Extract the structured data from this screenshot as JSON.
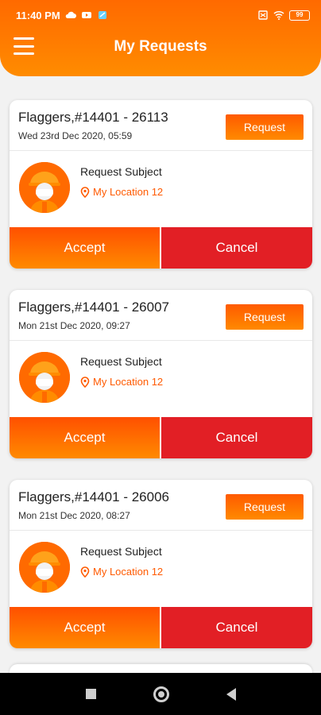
{
  "status_bar": {
    "time": "11:40 PM",
    "battery": "99"
  },
  "header": {
    "title": "My Requests"
  },
  "colors": {
    "primary_orange": "#ff6a00",
    "cancel_red": "#e21f25",
    "location_orange": "#ff5a00"
  },
  "requests": [
    {
      "title": "Flaggers,#14401 - 26113",
      "date": "Wed 23rd Dec 2020, 05:59",
      "request_label": "Request",
      "subject": "Request Subject",
      "location": "My Location 12",
      "accept_label": "Accept",
      "cancel_label": "Cancel"
    },
    {
      "title": "Flaggers,#14401 - 26007",
      "date": "Mon 21st Dec 2020, 09:27",
      "request_label": "Request",
      "subject": "Request Subject",
      "location": "My Location 12",
      "accept_label": "Accept",
      "cancel_label": "Cancel"
    },
    {
      "title": "Flaggers,#14401 - 26006",
      "date": "Mon 21st Dec 2020, 08:27",
      "request_label": "Request",
      "subject": "Request Subject",
      "location": "My Location 12",
      "accept_label": "Accept",
      "cancel_label": "Cancel"
    }
  ],
  "icons": {
    "menu": "hamburger-menu-icon",
    "location": "location-pin-icon",
    "avatar": "worker-avatar-icon",
    "nav_recent": "recent-apps-icon",
    "nav_home": "home-icon",
    "nav_back": "back-icon"
  }
}
